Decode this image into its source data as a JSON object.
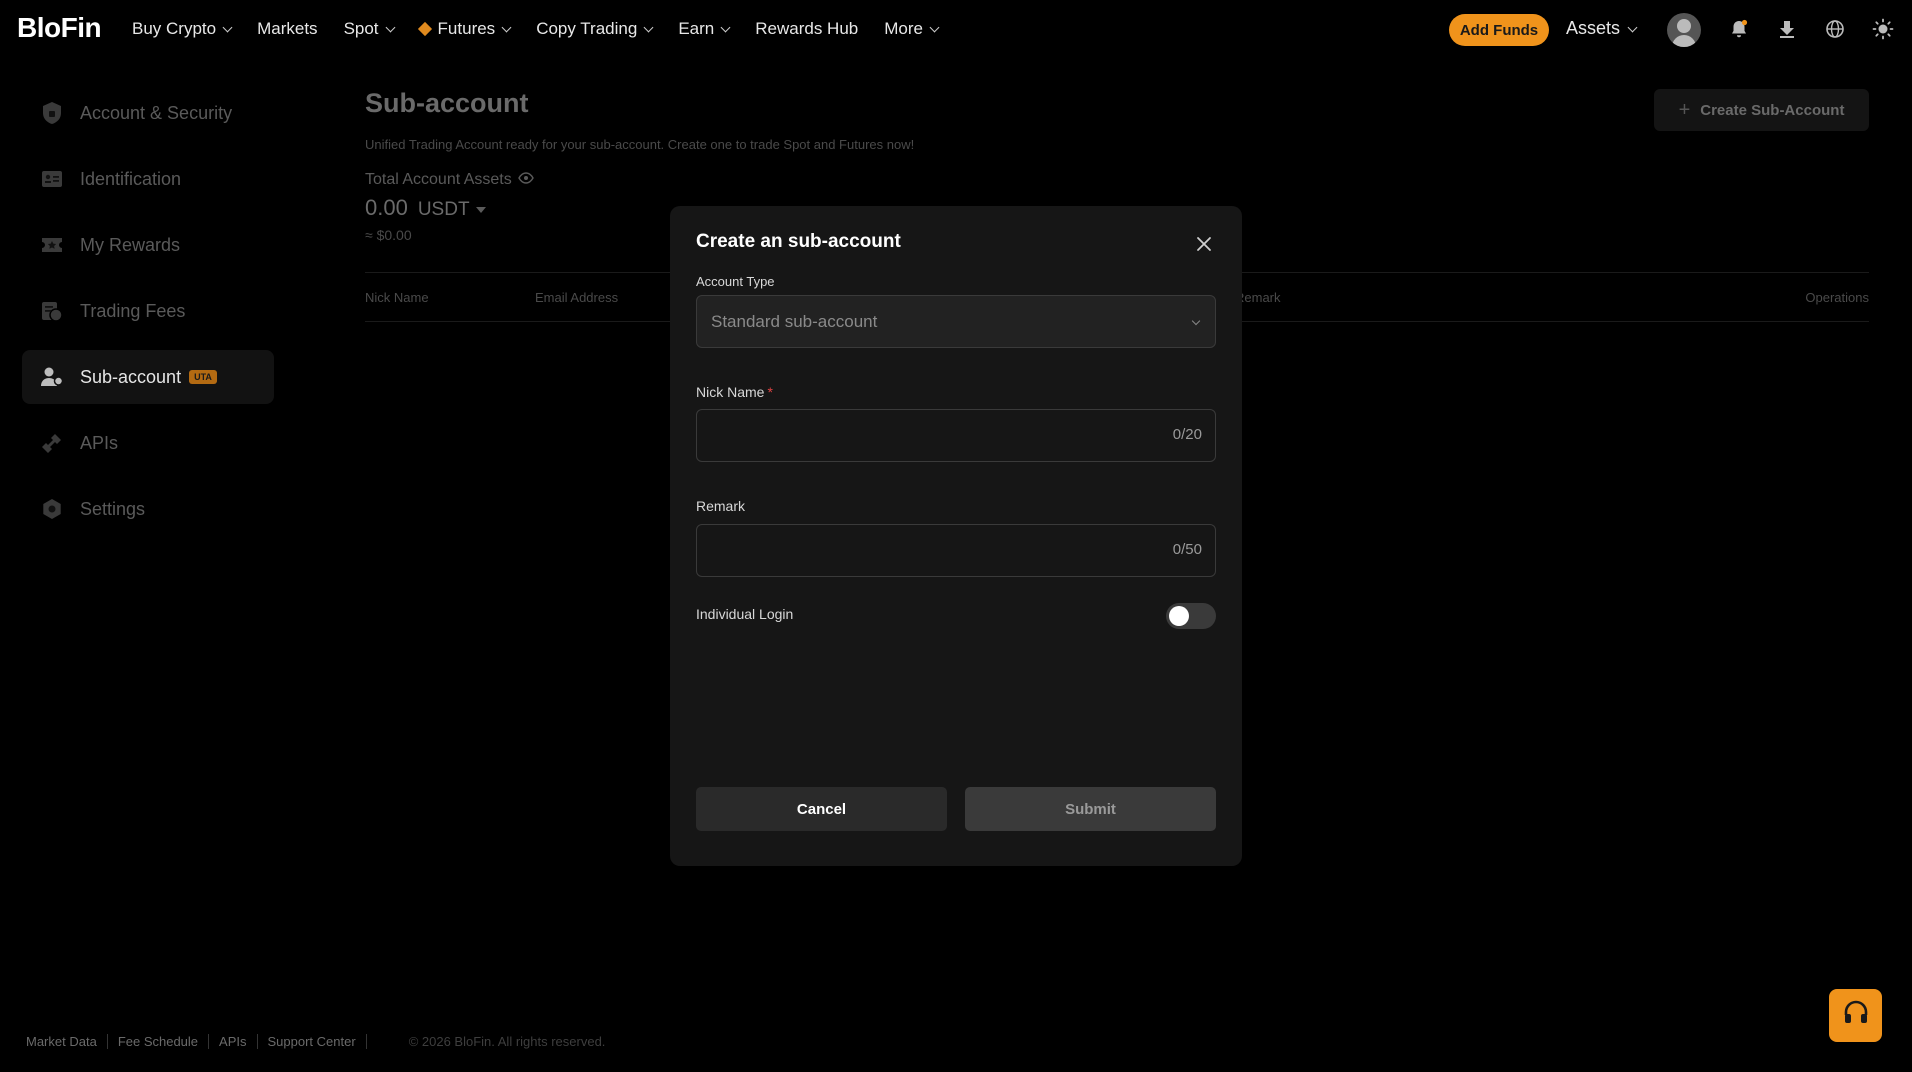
{
  "brand": {
    "logo": "BloFin",
    "accent": "#f0931b"
  },
  "topnav": {
    "items": [
      {
        "label": "Buy Crypto",
        "has_dropdown": true
      },
      {
        "label": "Markets",
        "has_dropdown": false
      },
      {
        "label": "Spot",
        "has_dropdown": true
      },
      {
        "label": "Futures",
        "has_dropdown": true
      },
      {
        "label": "Copy Trading",
        "has_dropdown": true
      },
      {
        "label": "Earn",
        "has_dropdown": true
      },
      {
        "label": "Rewards Hub",
        "has_dropdown": false
      },
      {
        "label": "More",
        "has_dropdown": true
      }
    ],
    "add_funds": "Add Funds",
    "assets": "Assets",
    "icons": [
      "avatar-icon",
      "bell-icon",
      "download-icon",
      "globe-icon",
      "sun-icon"
    ]
  },
  "sidebar": {
    "items": [
      {
        "label": "Account & Security",
        "icon": "shield-icon",
        "active": false
      },
      {
        "label": "Identification",
        "icon": "id-card-icon",
        "active": false
      },
      {
        "label": "My Rewards",
        "icon": "ticket-icon",
        "active": false
      },
      {
        "label": "Trading Fees",
        "icon": "fees-icon",
        "active": false
      },
      {
        "label": "Sub-account",
        "icon": "sub-account-icon",
        "active": true,
        "badge": "UTA"
      },
      {
        "label": "APIs",
        "icon": "api-icon",
        "active": false
      },
      {
        "label": "Settings",
        "icon": "settings-icon",
        "active": false
      }
    ]
  },
  "main": {
    "title": "Sub-account",
    "subtitle": "Unified Trading Account ready for your sub-account. Create one to trade Spot and Futures now!",
    "create_button": "Create Sub-Account",
    "total_label": "Total Account Assets",
    "total_value": "0.00",
    "total_currency": "USDT",
    "total_usd": "≈ $0.00",
    "table_headers": [
      "Nick Name",
      "Email Address",
      "Remark",
      "Operations"
    ]
  },
  "modal": {
    "title": "Create an sub-account",
    "account_type_label": "Account Type",
    "account_type_value": "Standard sub-account",
    "nickname_label": "Nick Name",
    "nickname_required": "*",
    "nickname_counter": "0/20",
    "remark_label": "Remark",
    "remark_counter": "0/50",
    "individual_login_label": "Individual Login",
    "individual_login_enabled": false,
    "cancel": "Cancel",
    "submit": "Submit"
  },
  "footer": {
    "links": [
      "Market Data",
      "Fee Schedule",
      "APIs",
      "Support Center"
    ],
    "copyright": "© 2026 BloFin. All rights reserved."
  }
}
